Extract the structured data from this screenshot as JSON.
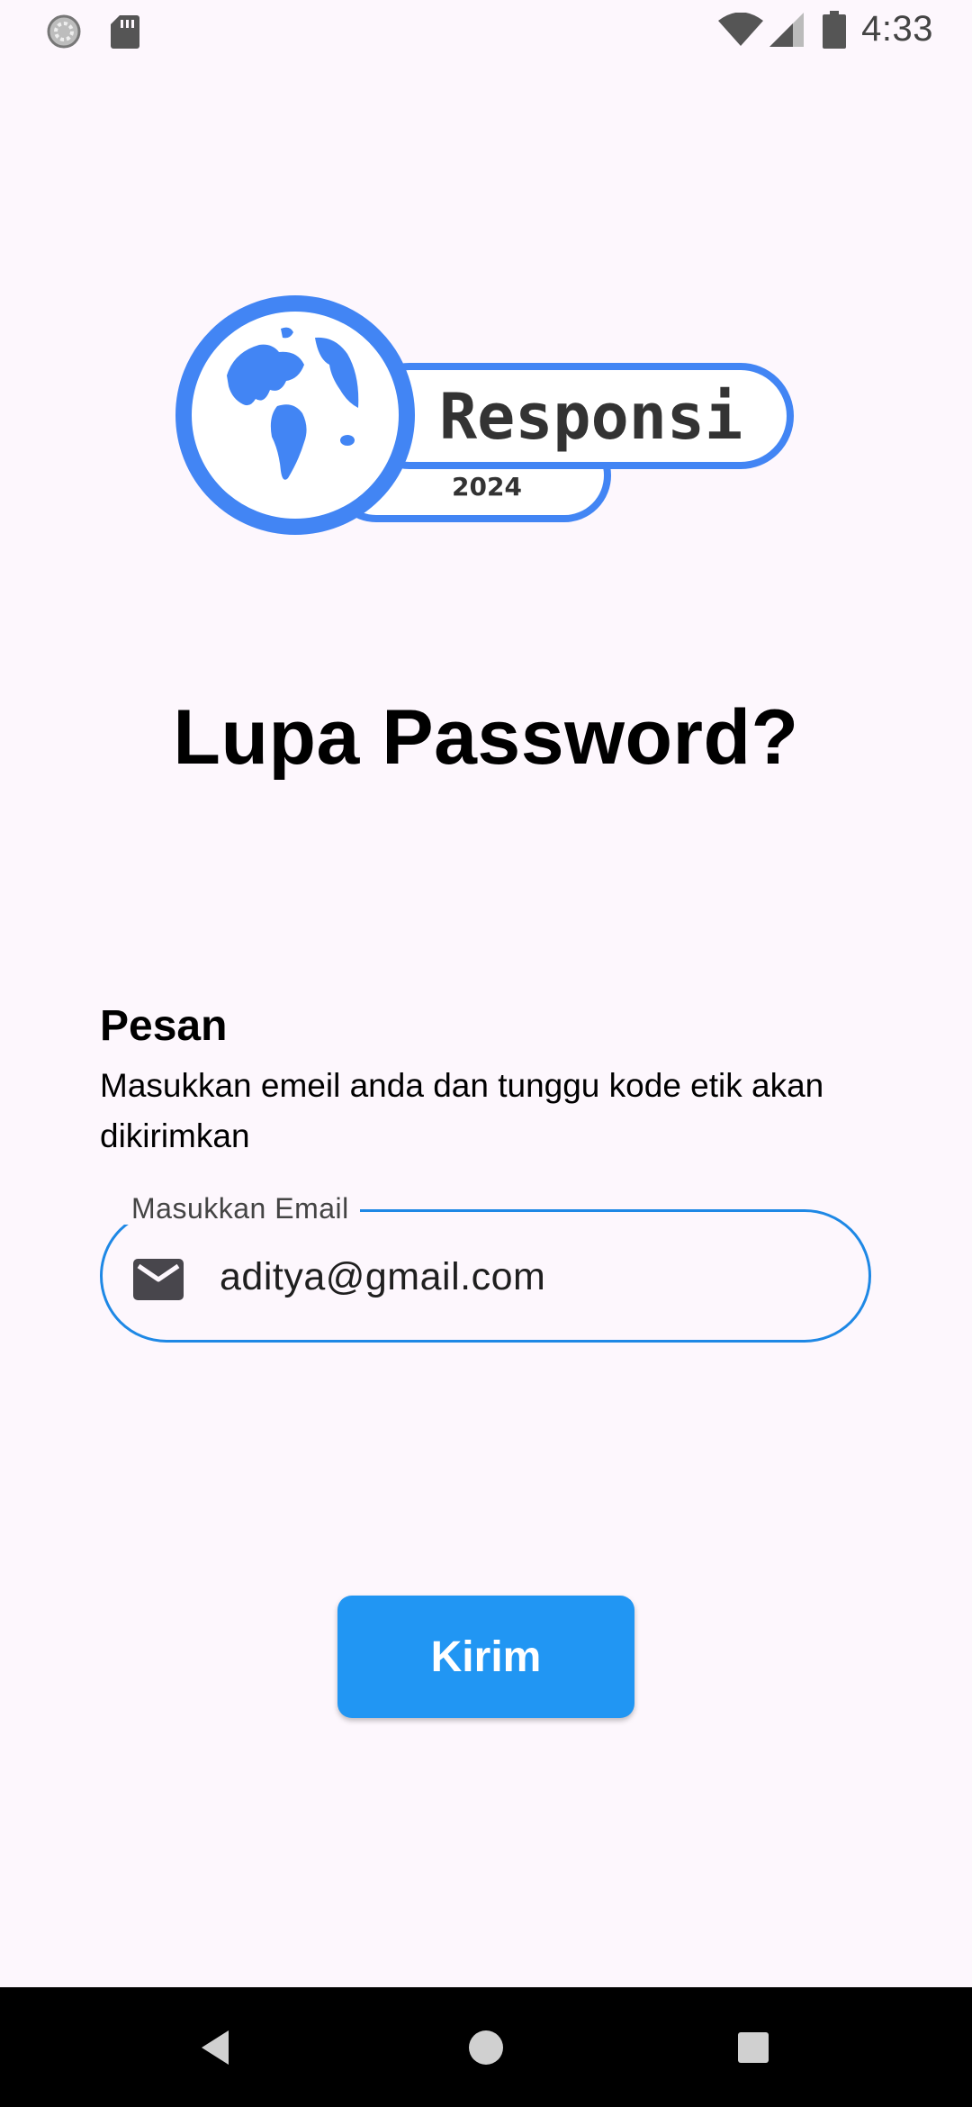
{
  "status_bar": {
    "time": "4:33",
    "icons": [
      "sync-icon",
      "sd-card-icon",
      "wifi-icon",
      "cellular-signal-icon",
      "battery-icon"
    ]
  },
  "logo": {
    "brand_text": "Responsi",
    "year_text": "2024",
    "colors": {
      "accent": "#4285f4",
      "text": "#333333"
    }
  },
  "page": {
    "title": "Lupa Password?"
  },
  "message": {
    "heading": "Pesan",
    "body": "Masukkan emeil anda dan tunggu kode etik akan dikirimkan"
  },
  "email_field": {
    "label": "Masukkan Email",
    "value": "aditya@gmail.com",
    "icon": "mail-icon",
    "border_color": "#1e88e5"
  },
  "submit": {
    "label": "Kirim",
    "color": "#2196f3"
  },
  "nav_bar": {
    "buttons": [
      "back-icon",
      "home-icon",
      "recents-icon"
    ]
  }
}
